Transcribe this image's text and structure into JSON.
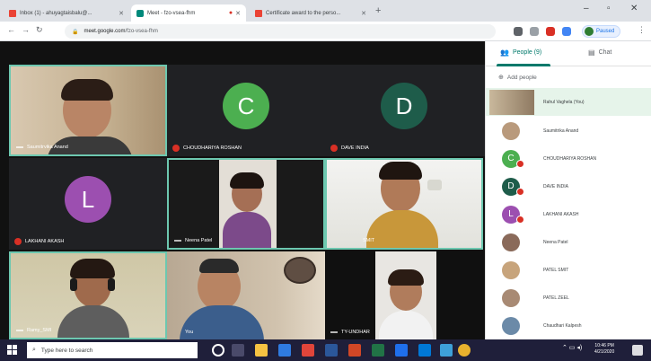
{
  "browser": {
    "tabs": [
      {
        "label": "Inbox (1) - ahuyagtaisbalu@..."
      },
      {
        "label": "Meet - fzo-vsea-fhm"
      },
      {
        "label": "Certificate award to the perso..."
      }
    ],
    "address": {
      "host": "meet.google.com",
      "path": "/fzo-vsea-fhm"
    },
    "profile_label": "Paused"
  },
  "meet": {
    "tiles": [
      {
        "name": "Saumitrvika Anand",
        "type": "video"
      },
      {
        "name": "CHOUDHARIYA ROSHAN",
        "type": "avatar",
        "initial": "C",
        "color": "#4caf50"
      },
      {
        "name": "DAVE INDIA",
        "type": "avatar",
        "initial": "D",
        "color": "#1e5c4a"
      },
      {
        "name": "LAKHANI AKASH",
        "type": "avatar",
        "initial": "L",
        "color": "#9c4fb0"
      },
      {
        "name": "Neena Patel",
        "type": "video"
      },
      {
        "name": "SMIT",
        "type": "video"
      },
      {
        "name": "Ramy_SMI",
        "type": "video"
      },
      {
        "name": "You",
        "type": "video"
      },
      {
        "name": "TY-UNDHAR",
        "type": "video"
      }
    ]
  },
  "panel": {
    "tabs": {
      "people": "People (9)",
      "chat": "Chat"
    },
    "add_people": "Add people",
    "people": [
      {
        "name": "Rahul Vaghela (You)",
        "type": "video"
      },
      {
        "name": "Saumitrika Anand",
        "type": "video"
      },
      {
        "name": "CHOUDHARIYA ROSHAN",
        "type": "avatar",
        "initial": "C",
        "color": "#4caf50"
      },
      {
        "name": "DAVE INDIA",
        "type": "avatar",
        "initial": "D",
        "color": "#1e5c4a"
      },
      {
        "name": "LAKHANI AKASH",
        "type": "avatar",
        "initial": "L",
        "color": "#9c4fb0"
      },
      {
        "name": "Neena Patel",
        "type": "video"
      },
      {
        "name": "PATEL SMIT",
        "type": "video"
      },
      {
        "name": "PATEL ZEEL",
        "type": "video"
      },
      {
        "name": "Chaudhari Kalpesh",
        "type": "video"
      }
    ]
  },
  "taskbar": {
    "search_placeholder": "Type here to search",
    "time": "10:46 PM",
    "date": "4/21/2020"
  },
  "colors": {
    "meet_bg": "#111111",
    "tile_bg": "#202124",
    "highlight": "#6dc8b0",
    "accent": "#00796b",
    "mic_off": "#d93025"
  }
}
